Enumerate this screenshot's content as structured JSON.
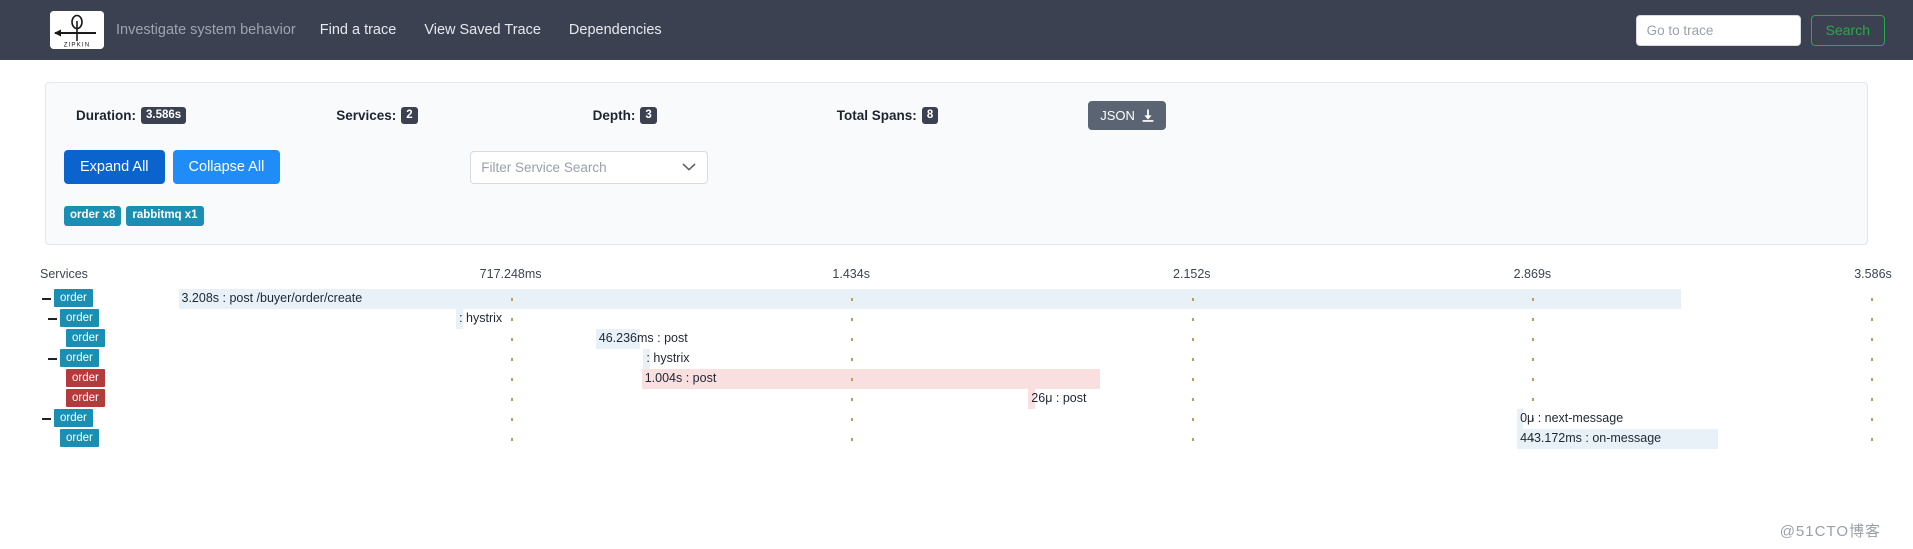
{
  "navbar": {
    "logo_alt": "ZIPKIN",
    "logo_text": "ZIPKIN",
    "tagline": "Investigate system behavior",
    "links": [
      {
        "label": "Find a trace"
      },
      {
        "label": "View Saved Trace"
      },
      {
        "label": "Dependencies"
      }
    ],
    "trace_input_placeholder": "Go to trace",
    "trace_input_value": "",
    "search_label": "Search",
    "bg_color": "#3b4151",
    "search_color": "#2ba84a"
  },
  "summary": {
    "stats": [
      {
        "label": "Duration:",
        "value": "3.586s"
      },
      {
        "label": "Services:",
        "value": "2"
      },
      {
        "label": "Depth:",
        "value": "3"
      },
      {
        "label": "Total Spans:",
        "value": "8"
      }
    ],
    "json_label": "JSON",
    "expand_all_label": "Expand All",
    "collapse_all_label": "Collapse All",
    "filter_placeholder": "Filter Service Search",
    "filter_value": "",
    "service_badges": [
      {
        "label": "order x8",
        "color": "#1b8fb3"
      },
      {
        "label": "rabbitmq x1",
        "color": "#1b8fb3"
      }
    ]
  },
  "timeline": {
    "services_header": "Services",
    "ticks": [
      {
        "label": "717.248ms",
        "pct": 20
      },
      {
        "label": "1.434s",
        "pct": 40
      },
      {
        "label": "2.152s",
        "pct": 60
      },
      {
        "label": "2.869s",
        "pct": 80
      },
      {
        "label": "3.586s",
        "pct": 100
      }
    ],
    "rows": [
      {
        "service": "order",
        "service_color": "blue",
        "depth": 0,
        "has_toggle": true,
        "label": "3.208s : post /buyer/order/create",
        "bar_start_pct": 0.5,
        "bar_width_pct": 88.2,
        "band": "blue"
      },
      {
        "service": "order",
        "service_color": "blue",
        "depth": 1,
        "has_toggle": true,
        "label": ": hystrix",
        "bar_start_pct": 16.8,
        "bar_width_pct": 0.4,
        "band": "blue"
      },
      {
        "service": "order",
        "service_color": "blue",
        "depth": 2,
        "has_toggle": false,
        "label": "46.236ms : post",
        "bar_start_pct": 25.0,
        "bar_width_pct": 2.6,
        "band": "blue"
      },
      {
        "service": "order",
        "service_color": "blue",
        "depth": 1,
        "has_toggle": true,
        "label": ": hystrix",
        "bar_start_pct": 27.8,
        "bar_width_pct": 0.4,
        "band": "blue"
      },
      {
        "service": "order",
        "service_color": "red",
        "depth": 2,
        "has_toggle": false,
        "label": "1.004s : post",
        "bar_start_pct": 27.7,
        "bar_width_pct": 26.9,
        "band": "pink"
      },
      {
        "service": "order",
        "service_color": "red",
        "depth": 2,
        "has_toggle": false,
        "label": "26μ : post",
        "bar_start_pct": 50.4,
        "bar_width_pct": 0.4,
        "band": "pink"
      },
      {
        "service": "order",
        "service_color": "blue",
        "depth": 0,
        "has_toggle": true,
        "label": "0μ : next-message",
        "bar_start_pct": 79.1,
        "bar_width_pct": 0.35,
        "band": "blue"
      },
      {
        "service": "order",
        "service_color": "blue",
        "depth": 1,
        "has_toggle": false,
        "label": "443.172ms : on-message",
        "bar_start_pct": 79.1,
        "bar_width_pct": 11.8,
        "band": "blue"
      }
    ]
  },
  "watermark": "@51CTO博客"
}
